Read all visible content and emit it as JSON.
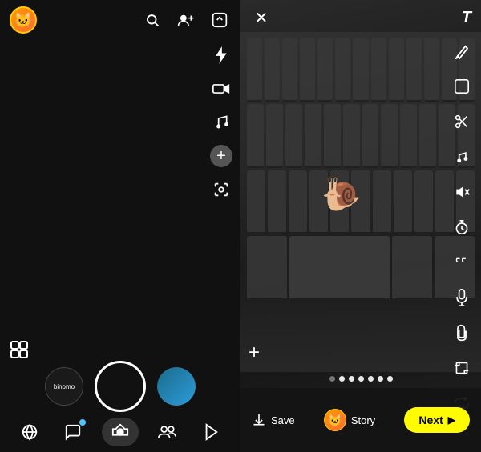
{
  "left": {
    "avatar_emoji": "🐱",
    "tools": {
      "flash": "⚡",
      "video": "📹",
      "music": "♪",
      "add": "+",
      "scan": "⊙"
    },
    "filters": [
      {
        "id": "binomo",
        "label": "binomo"
      },
      {
        "id": "thumb2",
        "label": ""
      }
    ],
    "nav": {
      "map": "⊕",
      "chat": "💬",
      "camera": "★",
      "friends": "👥",
      "stories": "▷"
    }
  },
  "right": {
    "tools": {
      "text": "T",
      "pencil": "✏",
      "sticker": "⬜",
      "scissors": "✂",
      "music": "♫",
      "mute": "🔇",
      "timer": "⟳",
      "quote": "❝",
      "mic": "🎤",
      "paperclip": "📎",
      "crop": "⊡",
      "loop": "⟲"
    },
    "snail": "🐌",
    "progress_dots": [
      false,
      true,
      true,
      true,
      true,
      true,
      true
    ],
    "add_label": "+",
    "bottom": {
      "save_label": "Save",
      "story_label": "Story",
      "next_label": "Next"
    }
  }
}
